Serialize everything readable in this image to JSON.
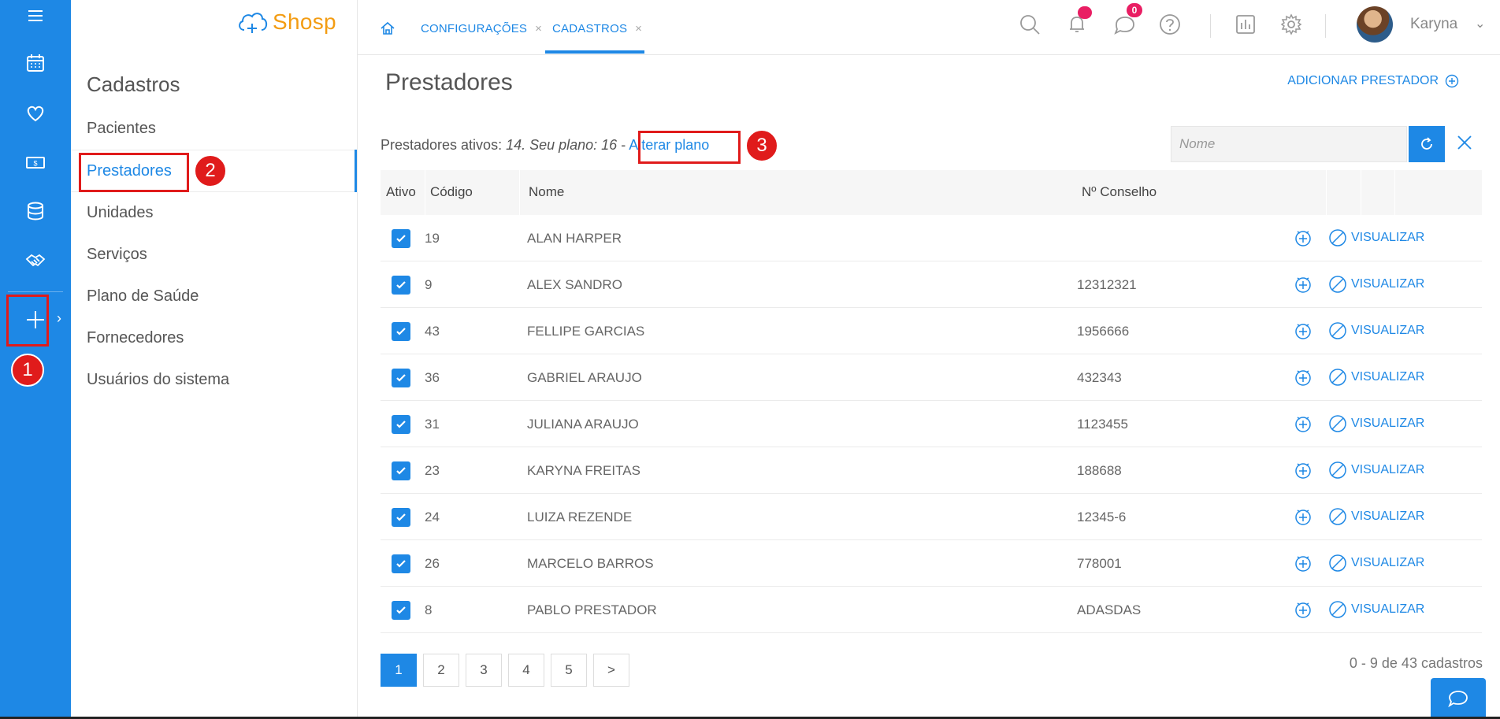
{
  "app": {
    "logo_text": "Shosp",
    "accent": "#1e88e5",
    "logo_color": "#f39c12"
  },
  "rail": {
    "icons": [
      "menu-icon",
      "calendar-icon",
      "heart-icon",
      "money-icon",
      "database-icon",
      "handshake-icon",
      "plus-icon"
    ]
  },
  "subnav": {
    "title": "Cadastros",
    "items": [
      {
        "label": "Pacientes"
      },
      {
        "label": "Prestadores"
      },
      {
        "label": "Unidades"
      },
      {
        "label": "Serviços"
      },
      {
        "label": "Plano de Saúde"
      },
      {
        "label": "Fornecedores"
      },
      {
        "label": "Usuários do sistema"
      }
    ]
  },
  "topbar": {
    "tabs": [
      {
        "label": "CONFIGURAÇÕES",
        "close": "×"
      },
      {
        "label": "CADASTROS",
        "close": "×"
      }
    ],
    "chat_badge": "0",
    "user_name": "Karyna",
    "chevron": "⌄"
  },
  "main": {
    "title": "Prestadores",
    "add_label": "ADICIONAR PRESTADOR",
    "plan_prefix": "Prestadores ativos: ",
    "plan_values": "14. Seu plano: 16",
    "plan_dash": " - ",
    "plan_link": "Alterar plano",
    "search_placeholder": "Nome",
    "columns": {
      "ativo": "Ativo",
      "codigo": "Código",
      "nome": "Nome",
      "conselho": "Nº Conselho"
    },
    "rows": [
      {
        "codigo": "19",
        "nome": "ALAN HARPER",
        "conselho": "",
        "action": "VISUALIZAR"
      },
      {
        "codigo": "9",
        "nome": "ALEX SANDRO",
        "conselho": "12312321",
        "action": "VISUALIZAR"
      },
      {
        "codigo": "43",
        "nome": "FELLIPE GARCIAS",
        "conselho": "1956666",
        "action": "VISUALIZAR"
      },
      {
        "codigo": "36",
        "nome": "GABRIEL ARAUJO",
        "conselho": "432343",
        "action": "VISUALIZAR"
      },
      {
        "codigo": "31",
        "nome": "JULIANA ARAUJO",
        "conselho": "1123455",
        "action": "VISUALIZAR"
      },
      {
        "codigo": "23",
        "nome": "KARYNA FREITAS",
        "conselho": "188688",
        "action": "VISUALIZAR"
      },
      {
        "codigo": "24",
        "nome": "LUIZA REZENDE",
        "conselho": "12345-6",
        "action": "VISUALIZAR"
      },
      {
        "codigo": "26",
        "nome": "MARCELO BARROS",
        "conselho": "778001",
        "action": "VISUALIZAR"
      },
      {
        "codigo": "8",
        "nome": "PABLO PRESTADOR",
        "conselho": "ADASDAS",
        "action": "VISUALIZAR"
      }
    ],
    "pages": [
      "1",
      "2",
      "3",
      "4",
      "5",
      ">"
    ],
    "count": "0 - 9 de 43 cadastros"
  },
  "annotations": {
    "n1": "1",
    "n2": "2",
    "n3": "3",
    "color": "#e01b1b"
  }
}
